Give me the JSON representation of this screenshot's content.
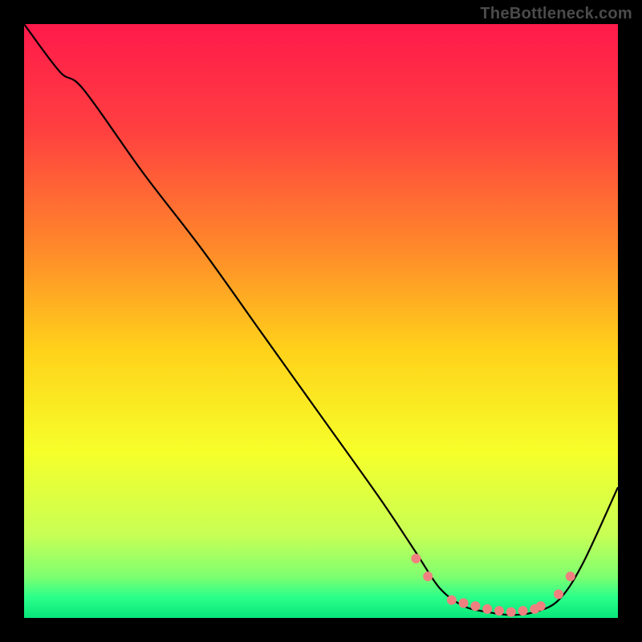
{
  "watermark": "TheBottleneck.com",
  "chart_data": {
    "type": "line",
    "title": "",
    "xlabel": "",
    "ylabel": "",
    "xlim": [
      0,
      100
    ],
    "ylim": [
      0,
      100
    ],
    "grid": false,
    "legend": false,
    "gradient_stops": [
      {
        "offset": 0.0,
        "color": "#ff1a4b"
      },
      {
        "offset": 0.18,
        "color": "#ff4040"
      },
      {
        "offset": 0.38,
        "color": "#ff8a2a"
      },
      {
        "offset": 0.55,
        "color": "#ffd21a"
      },
      {
        "offset": 0.72,
        "color": "#f6ff2a"
      },
      {
        "offset": 0.86,
        "color": "#c8ff55"
      },
      {
        "offset": 0.93,
        "color": "#7fff70"
      },
      {
        "offset": 0.965,
        "color": "#2bff8a"
      },
      {
        "offset": 1.0,
        "color": "#08e67a"
      }
    ],
    "series": [
      {
        "name": "bottleneck-curve",
        "color": "#000000",
        "x": [
          0,
          6,
          10,
          20,
          30,
          40,
          50,
          60,
          66,
          70,
          74,
          78,
          82,
          86,
          90,
          94,
          100
        ],
        "y": [
          100,
          92,
          89,
          75,
          62,
          48,
          34,
          20,
          11,
          5,
          2,
          1,
          0.5,
          1,
          3,
          9,
          22
        ]
      }
    ],
    "markers": {
      "color": "#f08080",
      "radius": 6,
      "x": [
        66,
        68,
        72,
        74,
        76,
        78,
        80,
        82,
        84,
        86,
        87,
        90,
        92
      ],
      "y": [
        10,
        7,
        3,
        2.5,
        2,
        1.5,
        1.2,
        1,
        1.2,
        1.5,
        2,
        4,
        7
      ]
    }
  }
}
